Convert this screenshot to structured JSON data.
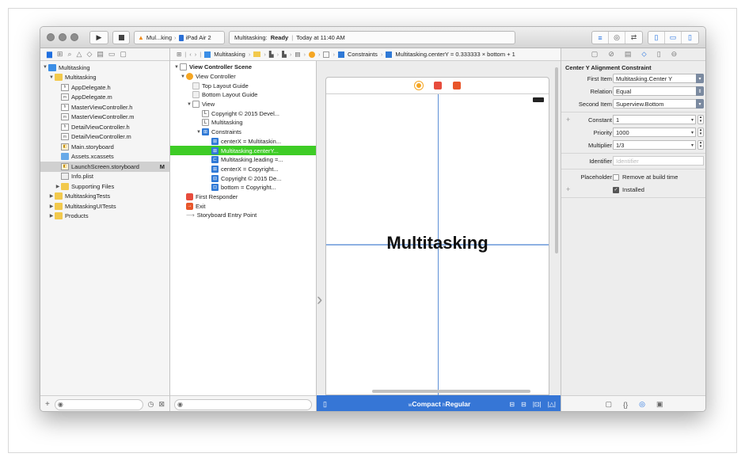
{
  "toolbar": {
    "scheme_target": "Mul...king",
    "scheme_device": "iPad Air 2",
    "status_app": "Multitasking:",
    "status_state": "Ready",
    "status_sep": "|",
    "status_time": "Today at 11:40 AM"
  },
  "navigator": {
    "items": [
      {
        "label": "Multitasking",
        "type": "project"
      },
      {
        "label": "Multitasking",
        "type": "folder"
      },
      {
        "label": "AppDelegate.h",
        "type": "h"
      },
      {
        "label": "AppDelegate.m",
        "type": "m"
      },
      {
        "label": "MasterViewController.h",
        "type": "h"
      },
      {
        "label": "MasterViewController.m",
        "type": "m"
      },
      {
        "label": "DetailViewController.h",
        "type": "h"
      },
      {
        "label": "DetailViewController.m",
        "type": "m"
      },
      {
        "label": "Main.storyboard",
        "type": "storyboard"
      },
      {
        "label": "Assets.xcassets",
        "type": "xcassets"
      },
      {
        "label": "LaunchScreen.storyboard",
        "type": "storyboard",
        "badge": "M"
      },
      {
        "label": "Info.plist",
        "type": "plist"
      },
      {
        "label": "Supporting Files",
        "type": "folder"
      },
      {
        "label": "MultitaskingTests",
        "type": "folder"
      },
      {
        "label": "MultitaskingUITests",
        "type": "folder"
      },
      {
        "label": "Products",
        "type": "folder"
      }
    ]
  },
  "jumpbar": {
    "project": "Multitasking",
    "constraints": "Constraints",
    "constraint_detail": "Multitasking.centerY = 0.333333 × bottom + 1"
  },
  "outline": {
    "items": [
      {
        "label": "View Controller Scene",
        "bold": true
      },
      {
        "label": "View Controller"
      },
      {
        "label": "Top Layout Guide"
      },
      {
        "label": "Bottom Layout Guide"
      },
      {
        "label": "View"
      },
      {
        "label": "Copyright © 2015 Devel..."
      },
      {
        "label": "Multitasking"
      },
      {
        "label": "Constraints"
      },
      {
        "label": "centerX = Multitaskin..."
      },
      {
        "label": "Multitasking.centerY..."
      },
      {
        "label": "Multitasking.leading =..."
      },
      {
        "label": "centerX = Copyright..."
      },
      {
        "label": "Copyright © 2015 De..."
      },
      {
        "label": "bottom = Copyright..."
      },
      {
        "label": "First Responder"
      },
      {
        "label": "Exit"
      },
      {
        "label": "Storyboard Entry Point"
      }
    ]
  },
  "canvas": {
    "label_text": "Multitasking"
  },
  "sizebar": {
    "w_prefix": "w",
    "w_value": "Compact",
    "h_prefix": "h",
    "h_value": "Regular"
  },
  "inspector": {
    "title": "Center Y Alignment Constraint",
    "first_item_label": "First Item",
    "first_item_value": "Multitasking.Center Y",
    "relation_label": "Relation",
    "relation_value": "Equal",
    "second_item_label": "Second Item",
    "second_item_value": "Superview.Bottom",
    "constant_label": "Constant",
    "constant_value": "1",
    "priority_label": "Priority",
    "priority_value": "1000",
    "multiplier_label": "Multiplier",
    "multiplier_value": "1/3",
    "identifier_label": "Identifier",
    "identifier_placeholder": "Identifier",
    "placeholder_label": "Placeholder",
    "remove_label": "Remove at build time",
    "installed_label": "Installed"
  },
  "colors": {
    "selection_green": "#3ecc26",
    "accent_blue": "#1f6fe0",
    "sizebar_blue": "#3676d6",
    "constraint_blue": "#5d8fd6"
  }
}
